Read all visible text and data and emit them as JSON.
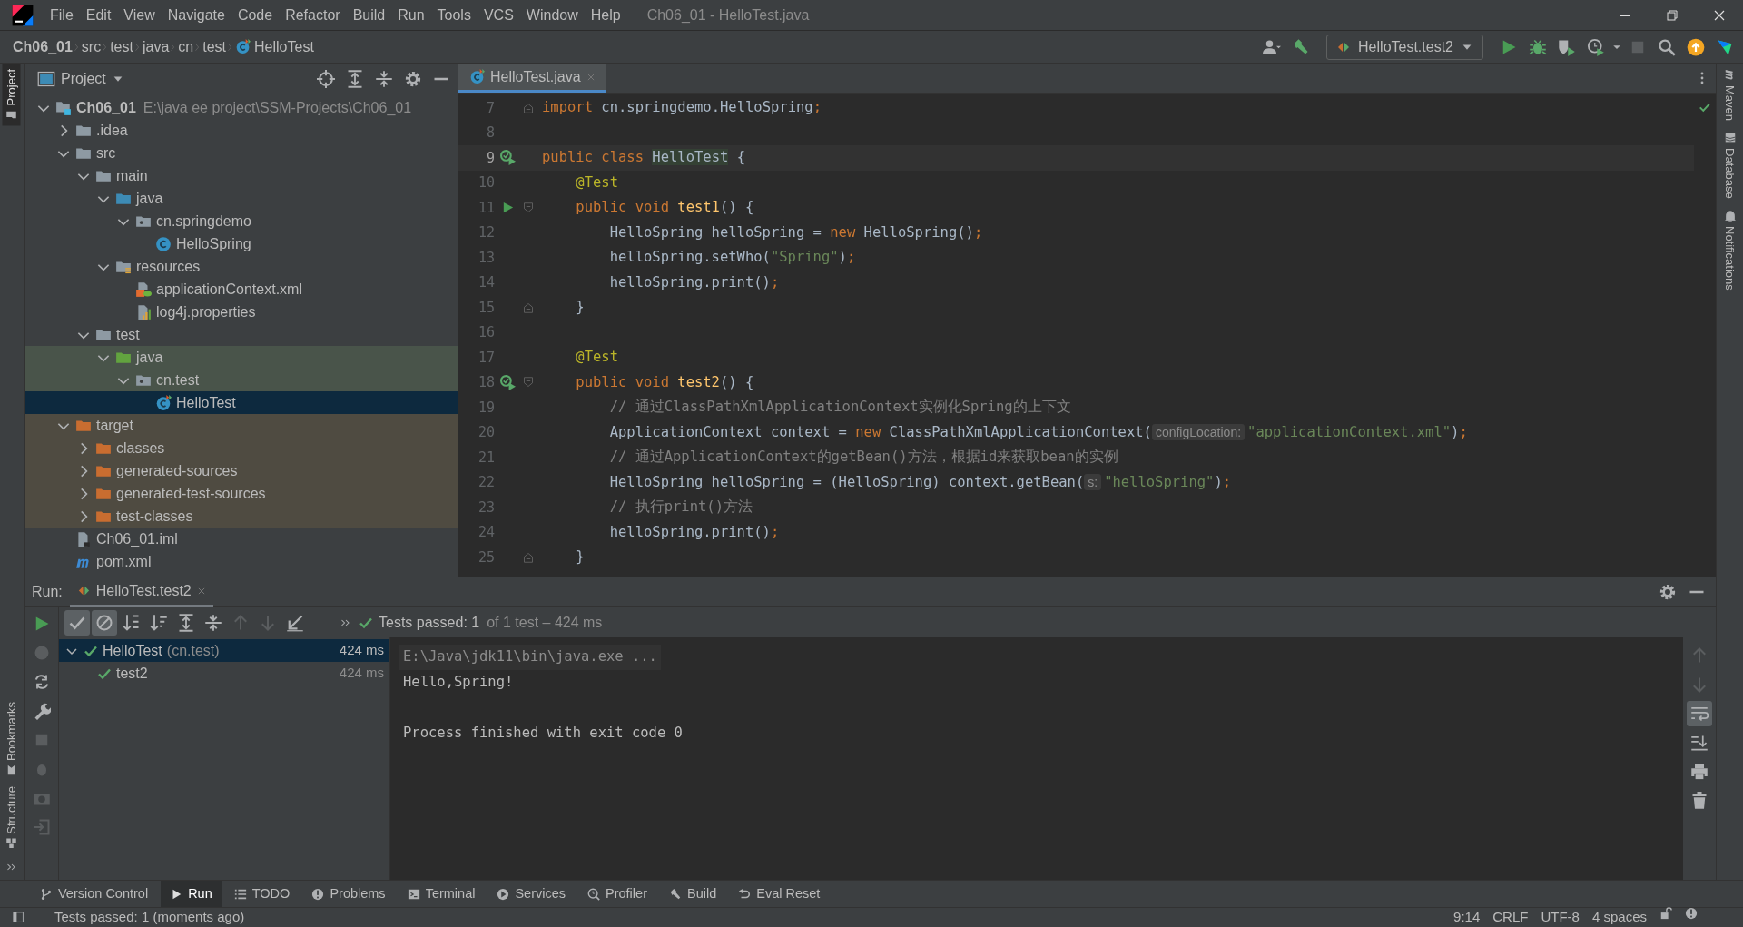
{
  "window": {
    "title": "Ch06_01 - HelloTest.java"
  },
  "menu": [
    "File",
    "Edit",
    "View",
    "Navigate",
    "Code",
    "Refactor",
    "Build",
    "Run",
    "Tools",
    "VCS",
    "Window",
    "Help"
  ],
  "breadcrumbs": [
    {
      "label": "Ch06_01",
      "kind": "module"
    },
    {
      "label": "src",
      "kind": "plain"
    },
    {
      "label": "test",
      "kind": "plain"
    },
    {
      "label": "java",
      "kind": "plain"
    },
    {
      "label": "cn",
      "kind": "plain"
    },
    {
      "label": "test",
      "kind": "plain"
    },
    {
      "label": "HelloTest",
      "kind": "test-class"
    }
  ],
  "run_configuration": {
    "label": "HelloTest.test2"
  },
  "left_stripe": [
    {
      "label": "Project",
      "selected": true
    },
    {
      "label": "Bookmarks",
      "selected": false
    },
    {
      "label": "Structure",
      "selected": false
    }
  ],
  "right_stripe": [
    {
      "label": "Maven",
      "kind": "maven"
    },
    {
      "label": "Database",
      "kind": "database"
    },
    {
      "label": "Notifications",
      "kind": "bell"
    }
  ],
  "project_panel": {
    "title": "Project",
    "tree": [
      {
        "label": "Ch06_01",
        "secondary": "E:\\java ee project\\SSM-Projects\\Ch06_01",
        "kind": "module",
        "expanded": true,
        "selected": false,
        "children": [
          {
            "label": ".idea",
            "kind": "folder",
            "expanded": false,
            "selected": false
          },
          {
            "label": "src",
            "kind": "folder",
            "expanded": true,
            "selected": false,
            "children": [
              {
                "label": "main",
                "kind": "folder",
                "expanded": true,
                "selected": false,
                "children": [
                  {
                    "label": "java",
                    "kind": "source-folder",
                    "expanded": true,
                    "selected": false,
                    "children": [
                      {
                        "label": "cn.springdemo",
                        "kind": "package",
                        "expanded": true,
                        "selected": false,
                        "children": [
                          {
                            "label": "HelloSpring",
                            "kind": "class",
                            "selected": false
                          }
                        ]
                      }
                    ]
                  },
                  {
                    "label": "resources",
                    "kind": "resources-folder",
                    "expanded": true,
                    "selected": false,
                    "children": [
                      {
                        "label": "applicationContext.xml",
                        "kind": "spring-xml",
                        "selected": false
                      },
                      {
                        "label": "log4j.properties",
                        "kind": "properties",
                        "selected": false
                      }
                    ]
                  }
                ]
              },
              {
                "label": "test",
                "kind": "folder",
                "expanded": true,
                "selected": false,
                "children": [
                  {
                    "label": "java",
                    "kind": "test-folder",
                    "expanded": true,
                    "selected": false,
                    "test_source": true,
                    "children": [
                      {
                        "label": "cn.test",
                        "kind": "package",
                        "expanded": true,
                        "selected": false,
                        "test_source": true,
                        "children": [
                          {
                            "label": "HelloTest",
                            "kind": "test-class",
                            "selected": true,
                            "test_source": true
                          }
                        ]
                      }
                    ]
                  }
                ]
              }
            ]
          },
          {
            "label": "target",
            "kind": "excluded-folder",
            "expanded": true,
            "selected": false,
            "excluded": true,
            "children": [
              {
                "label": "classes",
                "kind": "excluded-folder",
                "expanded": false,
                "selected": false,
                "excluded": true
              },
              {
                "label": "generated-sources",
                "kind": "excluded-folder",
                "expanded": false,
                "selected": false,
                "excluded": true
              },
              {
                "label": "generated-test-sources",
                "kind": "excluded-folder",
                "expanded": false,
                "selected": false,
                "excluded": true
              },
              {
                "label": "test-classes",
                "kind": "excluded-folder",
                "expanded": false,
                "selected": false,
                "excluded": true
              }
            ]
          },
          {
            "label": "Ch06_01.iml",
            "kind": "iml",
            "selected": false
          },
          {
            "label": "pom.xml",
            "kind": "maven",
            "selected": false
          }
        ]
      }
    ]
  },
  "editor": {
    "tabs": [
      {
        "label": "HelloTest.java",
        "selected": true
      }
    ],
    "lines": [
      {
        "number": "7",
        "fold_end": true,
        "tokens": [
          {
            "kind": "keyword",
            "text": "import"
          },
          {
            "kind": "plain",
            "text": " cn.springdemo.HelloSpring"
          },
          {
            "kind": "keyword",
            "text": ";"
          }
        ]
      },
      {
        "number": "8"
      },
      {
        "number": "9",
        "current": true,
        "run_marker": true,
        "passed": true,
        "tokens": [
          {
            "kind": "keyword",
            "text": "public class "
          },
          {
            "kind": "highlight",
            "text": "HelloTest"
          },
          {
            "kind": "plain",
            "text": " {"
          }
        ]
      },
      {
        "number": "10",
        "tokens": [
          {
            "kind": "annotation",
            "text": "    @Test"
          }
        ]
      },
      {
        "number": "11",
        "run_marker": true,
        "fold_start": true,
        "tokens": [
          {
            "kind": "keyword",
            "text": "    public void "
          },
          {
            "kind": "method",
            "text": "test1"
          },
          {
            "kind": "plain",
            "text": "() {"
          }
        ]
      },
      {
        "number": "12",
        "tokens": [
          {
            "kind": "plain",
            "text": "        HelloSpring helloSpring = "
          },
          {
            "kind": "keyword",
            "text": "new"
          },
          {
            "kind": "plain",
            "text": " HelloSpring()"
          },
          {
            "kind": "keyword",
            "text": ";"
          }
        ]
      },
      {
        "number": "13",
        "tokens": [
          {
            "kind": "plain",
            "text": "        helloSpring.setWho("
          },
          {
            "kind": "string",
            "text": "\"Spring\""
          },
          {
            "kind": "plain",
            "text": ")"
          },
          {
            "kind": "keyword",
            "text": ";"
          }
        ]
      },
      {
        "number": "14",
        "tokens": [
          {
            "kind": "plain",
            "text": "        helloSpring.print()"
          },
          {
            "kind": "keyword",
            "text": ";"
          }
        ]
      },
      {
        "number": "15",
        "fold_end": true,
        "tokens": [
          {
            "kind": "plain",
            "text": "    }"
          }
        ]
      },
      {
        "number": "16"
      },
      {
        "number": "17",
        "tokens": [
          {
            "kind": "annotation",
            "text": "    @Test"
          }
        ]
      },
      {
        "number": "18",
        "run_marker": true,
        "passed": true,
        "fold_start": true,
        "tokens": [
          {
            "kind": "keyword",
            "text": "    public void "
          },
          {
            "kind": "method",
            "text": "test2"
          },
          {
            "kind": "plain",
            "text": "() {"
          }
        ]
      },
      {
        "number": "19",
        "tokens": [
          {
            "kind": "comment",
            "text": "        // 通过ClassPathXmlApplicationContext实例化Spring的上下文"
          }
        ]
      },
      {
        "number": "20",
        "tokens": [
          {
            "kind": "plain",
            "text": "        ApplicationContext context = "
          },
          {
            "kind": "keyword",
            "text": "new"
          },
          {
            "kind": "plain",
            "text": " ClassPathXmlApplicationContext("
          },
          {
            "kind": "hint",
            "text": "configLocation:"
          },
          {
            "kind": "string",
            "text": "\"applicationContext.xml\""
          },
          {
            "kind": "plain",
            "text": ")"
          },
          {
            "kind": "keyword",
            "text": ";"
          }
        ]
      },
      {
        "number": "21",
        "tokens": [
          {
            "kind": "comment",
            "text": "        // 通过ApplicationContext的getBean()方法，根据id来获取bean的实例"
          }
        ]
      },
      {
        "number": "22",
        "tokens": [
          {
            "kind": "plain",
            "text": "        HelloSpring helloSpring = (HelloSpring) context.getBean("
          },
          {
            "kind": "hint",
            "text": "s:"
          },
          {
            "kind": "string",
            "text": "\"helloSpring\""
          },
          {
            "kind": "plain",
            "text": ")"
          },
          {
            "kind": "keyword",
            "text": ";"
          }
        ]
      },
      {
        "number": "23",
        "tokens": [
          {
            "kind": "comment",
            "text": "        // 执行print()方法"
          }
        ]
      },
      {
        "number": "24",
        "tokens": [
          {
            "kind": "plain",
            "text": "        helloSpring.print()"
          },
          {
            "kind": "keyword",
            "text": ";"
          }
        ]
      },
      {
        "number": "25",
        "fold_end": true,
        "tokens": [
          {
            "kind": "plain",
            "text": "    }"
          }
        ]
      }
    ]
  },
  "run_panel": {
    "label": "Run:",
    "tabs": [
      {
        "label": "HelloTest.test2",
        "selected": true
      }
    ],
    "status": "Tests passed: 1",
    "status_detail": "of 1 test – 424 ms",
    "tests": [
      {
        "label": "HelloTest",
        "secondary": "(cn.test)",
        "time": "424 ms",
        "passed": true,
        "selected": true,
        "expanded": true,
        "children": [
          {
            "label": "test2",
            "time": "424 ms",
            "passed": true,
            "selected": false
          }
        ]
      }
    ],
    "console": [
      {
        "kind": "command",
        "text": "E:\\Java\\jdk11\\bin\\java.exe ..."
      },
      {
        "kind": "output",
        "text": "Hello,Spring!"
      },
      {
        "kind": "blank"
      },
      {
        "kind": "output",
        "text": "Process finished with exit code 0"
      }
    ]
  },
  "tool_tabs": [
    {
      "label": "Version Control",
      "selected": false
    },
    {
      "label": "Run",
      "selected": true
    },
    {
      "label": "TODO",
      "selected": false
    },
    {
      "label": "Problems",
      "selected": false
    },
    {
      "label": "Terminal",
      "selected": false
    },
    {
      "label": "Services",
      "selected": false
    },
    {
      "label": "Profiler",
      "selected": false
    },
    {
      "label": "Build",
      "selected": false
    },
    {
      "label": "Eval Reset",
      "selected": false
    }
  ],
  "status_bar": {
    "message": "Tests passed: 1 (moments ago)",
    "items": [
      "9:14",
      "CRLF",
      "UTF-8",
      "4 spaces"
    ]
  }
}
